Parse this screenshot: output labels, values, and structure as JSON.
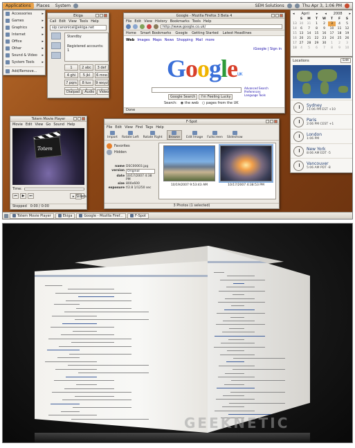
{
  "top_panel": {
    "menus": [
      "Applications",
      "Places",
      "System"
    ],
    "user": "SEM Solutions",
    "clock": "Thu Apr 3, 1:06 PM"
  },
  "apps_menu": {
    "items": [
      "Accessories",
      "Games",
      "Graphics",
      "Internet",
      "Office",
      "Other",
      "Sound & Video",
      "System Tools"
    ],
    "footer": "Add/Remove..."
  },
  "ekiga": {
    "title": "Ekiga",
    "menus": [
      "Call",
      "Edit",
      "View",
      "Tools",
      "Help"
    ],
    "address": "sip:canonical@ekiga.net",
    "status": "Standby",
    "accounts": "Registered accounts: 1",
    "keys": [
      "1",
      "2 abc",
      "3 def",
      "4 ghi",
      "5 jkl",
      "6 mno",
      "7 pqrs",
      "8 tuv",
      "9 wxyz",
      "*",
      "0",
      "#"
    ],
    "tabs": [
      "Dialpad",
      "Audio",
      "Video"
    ]
  },
  "firefox": {
    "title": "Google - Mozilla Firefox 3 Beta 4",
    "menus": [
      "File",
      "Edit",
      "View",
      "History",
      "Bookmarks",
      "Tools",
      "Help"
    ],
    "url": "http://www.google.co.uk/",
    "bookmarks": [
      "Home",
      "Smart Bookmarks",
      "Google",
      "Getting Started",
      "Latest Headlines"
    ],
    "links": [
      "Web",
      "Images",
      "Maps",
      "News",
      "Shopping",
      "Mail",
      "more"
    ],
    "signin": "iGoogle | Sign in",
    "logo": "Google",
    "logo_region": "UK",
    "advanced": [
      "Advanced Search",
      "Preferences",
      "Language Tools"
    ],
    "buttons": [
      "Google Search",
      "I'm Feeling Lucky"
    ],
    "search_label": "Search:",
    "radio": [
      "the web",
      "pages from the UK"
    ],
    "status": "Done"
  },
  "calendar": {
    "month": "April",
    "year": "2008",
    "days": [
      "S",
      "M",
      "T",
      "W",
      "T",
      "F",
      "S"
    ],
    "rows": [
      [
        "13",
        "30",
        "31",
        "1",
        "2",
        "3",
        "4",
        "5"
      ],
      [
        "14",
        "6",
        "7",
        "8",
        "9",
        "10",
        "11",
        "12"
      ],
      [
        "15",
        "13",
        "14",
        "15",
        "16",
        "17",
        "18",
        "19"
      ],
      [
        "16",
        "20",
        "21",
        "22",
        "23",
        "24",
        "25",
        "26"
      ],
      [
        "17",
        "27",
        "28",
        "29",
        "30",
        "1",
        "2",
        "3"
      ],
      [
        "18",
        "4",
        "5",
        "6",
        "7",
        "8",
        "9",
        "10"
      ]
    ]
  },
  "locations": {
    "title": "Locations",
    "edit": "Edit",
    "cities": [
      {
        "name": "Sydney",
        "time": "11:06 PM EST +10"
      },
      {
        "name": "Paris",
        "time": "2:06 PM CEST +1"
      },
      {
        "name": "London",
        "time": "1:06 PM"
      },
      {
        "name": "New York",
        "time": "8:06 AM EDT -5"
      },
      {
        "name": "Vancouver",
        "time": "5:06 AM PDT -8"
      }
    ]
  },
  "totem": {
    "title": "Totem Movie Player",
    "menus": [
      "Movie",
      "Edit",
      "View",
      "Go",
      "Sound",
      "Help"
    ],
    "logo": "Totem",
    "time_label": "Time:",
    "sidebar": "Sidebar",
    "status": "Stopped",
    "position": "0:00 / 0:00"
  },
  "fspot": {
    "title": "F-Spot",
    "menus": [
      "File",
      "Edit",
      "View",
      "Find",
      "Tags",
      "Help"
    ],
    "tools": [
      "Import",
      "Rotate Left",
      "Rotate Right",
      "Browse",
      "Edit Image",
      "Fullscreen",
      "Slideshow"
    ],
    "tags": [
      "Favorites",
      "Hidden"
    ],
    "meta": [
      {
        "k": "name",
        "v": "DSC00003.jpg"
      },
      {
        "k": "version",
        "v": "Original"
      },
      {
        "k": "date",
        "v": "10/17/2007 4:38 PM"
      },
      {
        "k": "size",
        "v": "800x600"
      },
      {
        "k": "exposure",
        "v": "f/2.8 1/1250 sec"
      }
    ],
    "photos": [
      {
        "caption": "10/19/2007 9:53:43 AM"
      },
      {
        "caption": "10/17/2007 4:38:53 PM"
      }
    ],
    "status": "3 Photos (1 selected)"
  },
  "taskbar": {
    "tasks": [
      "Totem Movie Player",
      "Ekiga",
      "Google - Mozilla Firef...",
      "F-Spot"
    ]
  },
  "cube": {
    "watermark": "GEEKNETIC"
  }
}
